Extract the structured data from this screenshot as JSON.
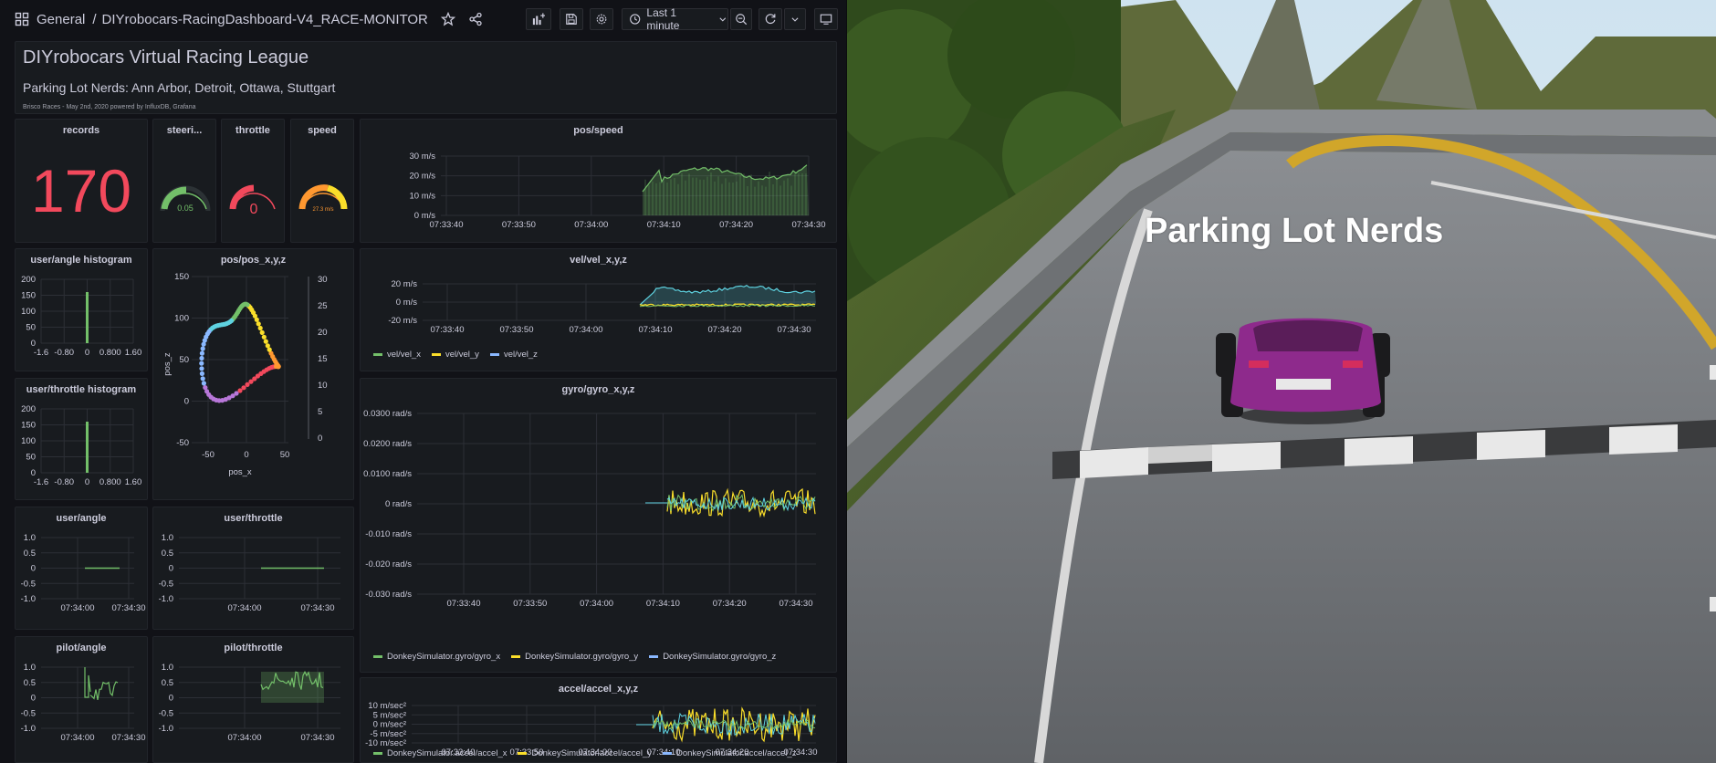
{
  "topbar": {
    "folder": "General",
    "separator": "/",
    "title": "DIYrobocars-RacingDashboard-V4_RACE-MONITOR",
    "time_range": "Last 1 minute"
  },
  "text_panel": {
    "title": "DIYrobocars Virtual Racing League",
    "subtitle": "Parking Lot Nerds: Ann Arbor, Detroit, Ottawa, Stuttgart",
    "footer": "Brisco Races - May 2nd, 2020 powered by InfluxDB, Grafana"
  },
  "colors": {
    "background": "#111217",
    "panel": "#181b1f",
    "green": "#73bf69",
    "yellow": "#fade2a",
    "blue": "#8ab8ff",
    "red": "#f2495c",
    "cyan": "#5ed2e0"
  },
  "stats": {
    "records": {
      "title": "records",
      "value": "170"
    },
    "steering": {
      "title": "steeri...",
      "value": "0.05",
      "level": 0.525
    },
    "throttle": {
      "title": "throttle",
      "value": "0",
      "level": 0.5
    },
    "speed": {
      "title": "speed",
      "value": "27.3 m/s",
      "level": 0.55
    }
  },
  "panels": {
    "pos_speed": {
      "title": "pos/speed",
      "ticks_y": [
        "30 m/s",
        "20 m/s",
        "10 m/s",
        "0 m/s"
      ],
      "ticks_x": [
        "07:33:40",
        "07:33:50",
        "07:34:00",
        "07:34:10",
        "07:34:20",
        "07:34:30"
      ]
    },
    "vel": {
      "title": "vel/vel_x,y,z",
      "ticks_y": [
        "20 m/s",
        "0 m/s",
        "-20 m/s"
      ],
      "ticks_x": [
        "07:33:40",
        "07:33:50",
        "07:34:00",
        "07:34:10",
        "07:34:20",
        "07:34:30"
      ],
      "legend": [
        "vel/vel_x",
        "vel/vel_y",
        "vel/vel_z"
      ]
    },
    "gyro": {
      "title": "gyro/gyro_x,y,z",
      "ticks_y": [
        "0.0300 rad/s",
        "0.0200 rad/s",
        "0.0100 rad/s",
        "0 rad/s",
        "-0.010 rad/s",
        "-0.020 rad/s",
        "-0.030 rad/s"
      ],
      "ticks_x": [
        "07:33:40",
        "07:33:50",
        "07:34:00",
        "07:34:10",
        "07:34:20",
        "07:34:30"
      ],
      "legend": [
        "DonkeySimulator.gyro/gyro_x",
        "DonkeySimulator.gyro/gyro_y",
        "DonkeySimulator.gyro/gyro_z"
      ]
    },
    "accel": {
      "title": "accel/accel_x,y,z",
      "ticks_y": [
        "10 m/sec²",
        "5 m/sec²",
        "0 m/sec²",
        "-5 m/sec²",
        "-10 m/sec²"
      ],
      "ticks_x": [
        "07:33:40",
        "07:33:50",
        "07:34:00",
        "07:34:10",
        "07:34:20",
        "07:34:30"
      ],
      "legend": [
        "DonkeySimulator.accel/accel_x",
        "DonkeySimulator.accel/accel_y",
        "DonkeySimulator.accel/accel_z"
      ]
    },
    "angle_hist": {
      "title": "user/angle histogram",
      "ticks_y": [
        "200",
        "150",
        "100",
        "50",
        "0"
      ],
      "ticks_x": [
        "-1.6",
        "-0.80",
        "0",
        "0.800",
        "1.60"
      ]
    },
    "throttle_hist": {
      "title": "user/throttle histogram",
      "ticks_y": [
        "200",
        "150",
        "100",
        "50",
        "0"
      ],
      "ticks_x": [
        "-1.6",
        "-0.80",
        "0",
        "0.800",
        "1.60"
      ]
    },
    "pos_xyz": {
      "title": "pos/pos_x,y,z",
      "ticks_y": [
        "150",
        "100",
        "50",
        "0",
        "-50"
      ],
      "ticks_x": [
        "-50",
        "0",
        "50"
      ],
      "xlabel": "pos_x",
      "ylabel": "pos_z",
      "scale_ticks": [
        "30",
        "25",
        "20",
        "15",
        "10",
        "5",
        "0"
      ]
    },
    "user_angle": {
      "title": "user/angle",
      "ticks_y": [
        "1.0",
        "0.5",
        "0",
        "-0.5",
        "-1.0"
      ],
      "ticks_x": [
        "07:34:00",
        "07:34:30"
      ]
    },
    "user_throttle": {
      "title": "user/throttle",
      "ticks_y": [
        "1.0",
        "0.5",
        "0",
        "-0.5",
        "-1.0"
      ],
      "ticks_x": [
        "07:34:00",
        "07:34:30"
      ]
    },
    "pilot_angle": {
      "title": "pilot/angle",
      "ticks_y": [
        "1.0",
        "0.5",
        "0",
        "-0.5",
        "-1.0"
      ],
      "ticks_x": [
        "07:34:00",
        "07:34:30"
      ]
    },
    "pilot_throttle": {
      "title": "pilot/throttle",
      "ticks_y": [
        "1.0",
        "0.5",
        "0",
        "-0.5",
        "-1.0"
      ],
      "ticks_x": [
        "07:34:00",
        "07:34:30"
      ]
    }
  },
  "simulator": {
    "label": "Parking Lot Nerds"
  }
}
